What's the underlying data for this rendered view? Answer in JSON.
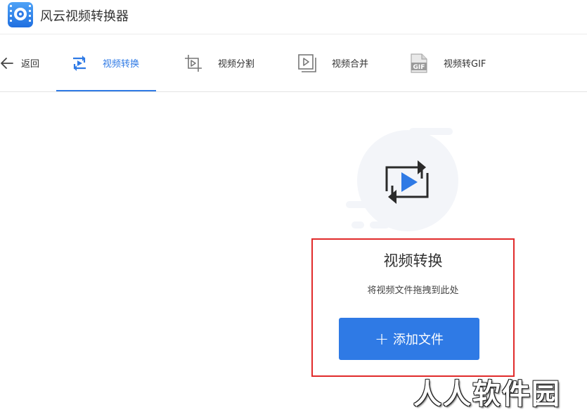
{
  "app": {
    "title": "风云视频转换器",
    "icon": "app-logo-icon",
    "brand_color": "#2f7ae5"
  },
  "nav": {
    "back_label": "返回",
    "tabs": [
      {
        "label": "视频转换",
        "icon": "convert-icon",
        "active": true
      },
      {
        "label": "视频分割",
        "icon": "crop-icon",
        "active": false
      },
      {
        "label": "视频合并",
        "icon": "merge-icon",
        "active": false
      },
      {
        "label": "视频转GIF",
        "icon": "gif-icon",
        "active": false
      }
    ]
  },
  "main": {
    "hero_icon": "convert-illustration-icon",
    "title": "视频转换",
    "hint": "将视频文件拖拽到此处",
    "add_button_label": "添加文件",
    "highlight_color": "#e12b2b"
  },
  "watermark": "人人软件园"
}
